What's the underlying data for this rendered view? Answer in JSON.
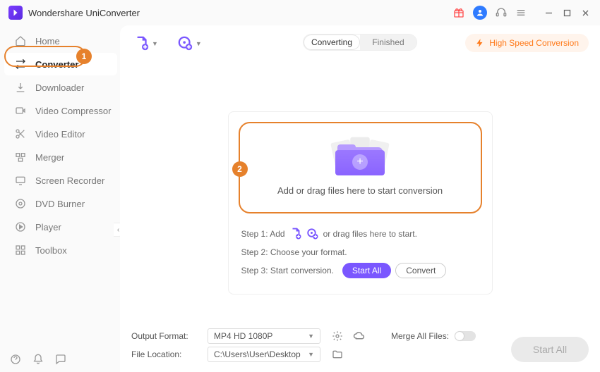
{
  "title": "Wondershare UniConverter",
  "sidebar": [
    {
      "label": "Home",
      "name": "sidebar-item-home"
    },
    {
      "label": "Converter",
      "name": "sidebar-item-converter"
    },
    {
      "label": "Downloader",
      "name": "sidebar-item-downloader"
    },
    {
      "label": "Video Compressor",
      "name": "sidebar-item-video-compressor"
    },
    {
      "label": "Video Editor",
      "name": "sidebar-item-video-editor"
    },
    {
      "label": "Merger",
      "name": "sidebar-item-merger"
    },
    {
      "label": "Screen Recorder",
      "name": "sidebar-item-screen-recorder"
    },
    {
      "label": "DVD Burner",
      "name": "sidebar-item-dvd-burner"
    },
    {
      "label": "Player",
      "name": "sidebar-item-player"
    },
    {
      "label": "Toolbox",
      "name": "sidebar-item-toolbox"
    }
  ],
  "tabs": {
    "converting": "Converting",
    "finished": "Finished"
  },
  "high_speed_label": "High Speed Conversion",
  "drop_text": "Add or drag files here to start conversion",
  "steps": {
    "s1_prefix": "Step 1: Add",
    "s1_suffix": "or drag files here to start.",
    "s2": "Step 2: Choose your format.",
    "s3": "Step 3: Start conversion.",
    "start_all": "Start All",
    "convert": "Convert"
  },
  "bottom": {
    "output_label": "Output Format:",
    "output_value": "MP4 HD 1080P",
    "file_label": "File Location:",
    "file_value": "C:\\Users\\User\\Desktop",
    "merge_label": "Merge All Files:",
    "start_all": "Start All"
  },
  "annotations": {
    "badge1": "1",
    "badge2": "2"
  }
}
